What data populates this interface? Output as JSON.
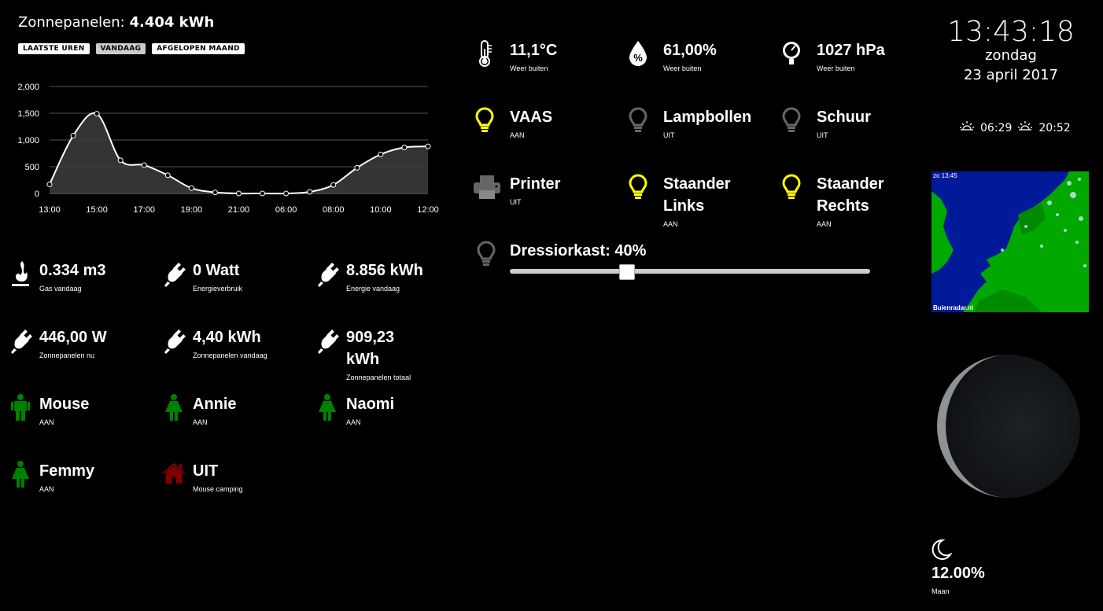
{
  "chart": {
    "title_prefix": "Zonnepanelen:",
    "title_value": "4.404 kWh",
    "buttons": [
      {
        "label": "LAATSTE UREN",
        "active": false
      },
      {
        "label": "VANDAAG",
        "active": true
      },
      {
        "label": "AFGELOPEN MAAND",
        "active": false
      }
    ]
  },
  "chart_data": {
    "type": "area",
    "x": [
      "13:00",
      "14:00",
      "15:00",
      "16:00",
      "17:00",
      "18:00",
      "19:00",
      "20:00",
      "21:00",
      "22:00",
      "06:00",
      "07:00",
      "08:00",
      "09:00",
      "10:00",
      "11:00",
      "12:00"
    ],
    "values": [
      170,
      1080,
      1490,
      620,
      530,
      340,
      100,
      20,
      0,
      0,
      0,
      30,
      160,
      480,
      730,
      860,
      880
    ],
    "xticks": [
      "13:00",
      "15:00",
      "17:00",
      "19:00",
      "21:00",
      "06:00",
      "08:00",
      "10:00",
      "12:00"
    ],
    "yticks": [
      "0",
      "500",
      "1,000",
      "1,500",
      "2,000"
    ],
    "ylim": [
      0,
      2000
    ],
    "grid": true,
    "line_color": "#ffffff",
    "fill_color": "#3a3a3a"
  },
  "weather": [
    {
      "value": "11,1°C",
      "label": "Weer buiten",
      "icon": "thermometer-icon"
    },
    {
      "value": "61,00%",
      "label": "Weer buiten",
      "icon": "humidity-icon"
    },
    {
      "value": "1027 hPa",
      "label": "Weer buiten",
      "icon": "barometer-icon"
    }
  ],
  "switches": [
    {
      "value": "VAAS",
      "label": "AAN",
      "icon": "bulb-icon",
      "on": true
    },
    {
      "value": "Lampbollen",
      "label": "UIT",
      "icon": "bulb-icon",
      "on": false
    },
    {
      "value": "Schuur",
      "label": "UIT",
      "icon": "bulb-icon",
      "on": false
    },
    {
      "value": "Printer",
      "label": "UIT",
      "icon": "printer-icon",
      "on": false
    },
    {
      "value": "Staander Links",
      "label": "AAN",
      "icon": "bulb-icon",
      "on": true
    },
    {
      "value": "Staander Rechts",
      "label": "AAN",
      "icon": "bulb-icon",
      "on": true
    }
  ],
  "dimmer": {
    "label": "Dressiorkast: 40%",
    "level": 0.4
  },
  "energy": [
    {
      "value": "0.334 m3",
      "label": "Gas vandaag",
      "icon": "flame-icon"
    },
    {
      "value": "0 Watt",
      "label": "Energieverbruik",
      "icon": "plug-icon"
    },
    {
      "value": "8.856 kWh",
      "label": "Energie vandaag",
      "icon": "plug-icon"
    },
    {
      "value": "446,00 W",
      "label": "Zonnepanelen nu",
      "icon": "plug-icon"
    },
    {
      "value": "4,40 kWh",
      "label": "Zonnepanelen vandaag",
      "icon": "plug-icon"
    },
    {
      "value": "909,23 kWh",
      "label": "Zonnepanelen totaal",
      "icon": "plug-icon"
    }
  ],
  "persons": [
    {
      "value": "Mouse",
      "label": "AAN",
      "icon": "man-icon"
    },
    {
      "value": "Annie",
      "label": "AAN",
      "icon": "woman-icon"
    },
    {
      "value": "Naomi",
      "label": "AAN",
      "icon": "woman-icon"
    },
    {
      "value": "Femmy",
      "label": "AAN",
      "icon": "woman-icon"
    },
    {
      "value": "UIT",
      "label": "Mouse camping",
      "icon": "home-icon"
    }
  ],
  "clock": {
    "time": "13:43:18",
    "day": "zondag",
    "date": "23 april 2017"
  },
  "sun": {
    "sunrise": "06:29",
    "sunset": "20:52"
  },
  "radar": {
    "timestamp": "zo 13:45",
    "source": "Buienradar.nl"
  },
  "moon": {
    "value": "12.00%",
    "label": "Maan",
    "illumination": 0.12
  },
  "colors": {
    "green": "#008000",
    "yellow": "#ffff00",
    "grey": "#666666",
    "darkred": "#800000"
  }
}
